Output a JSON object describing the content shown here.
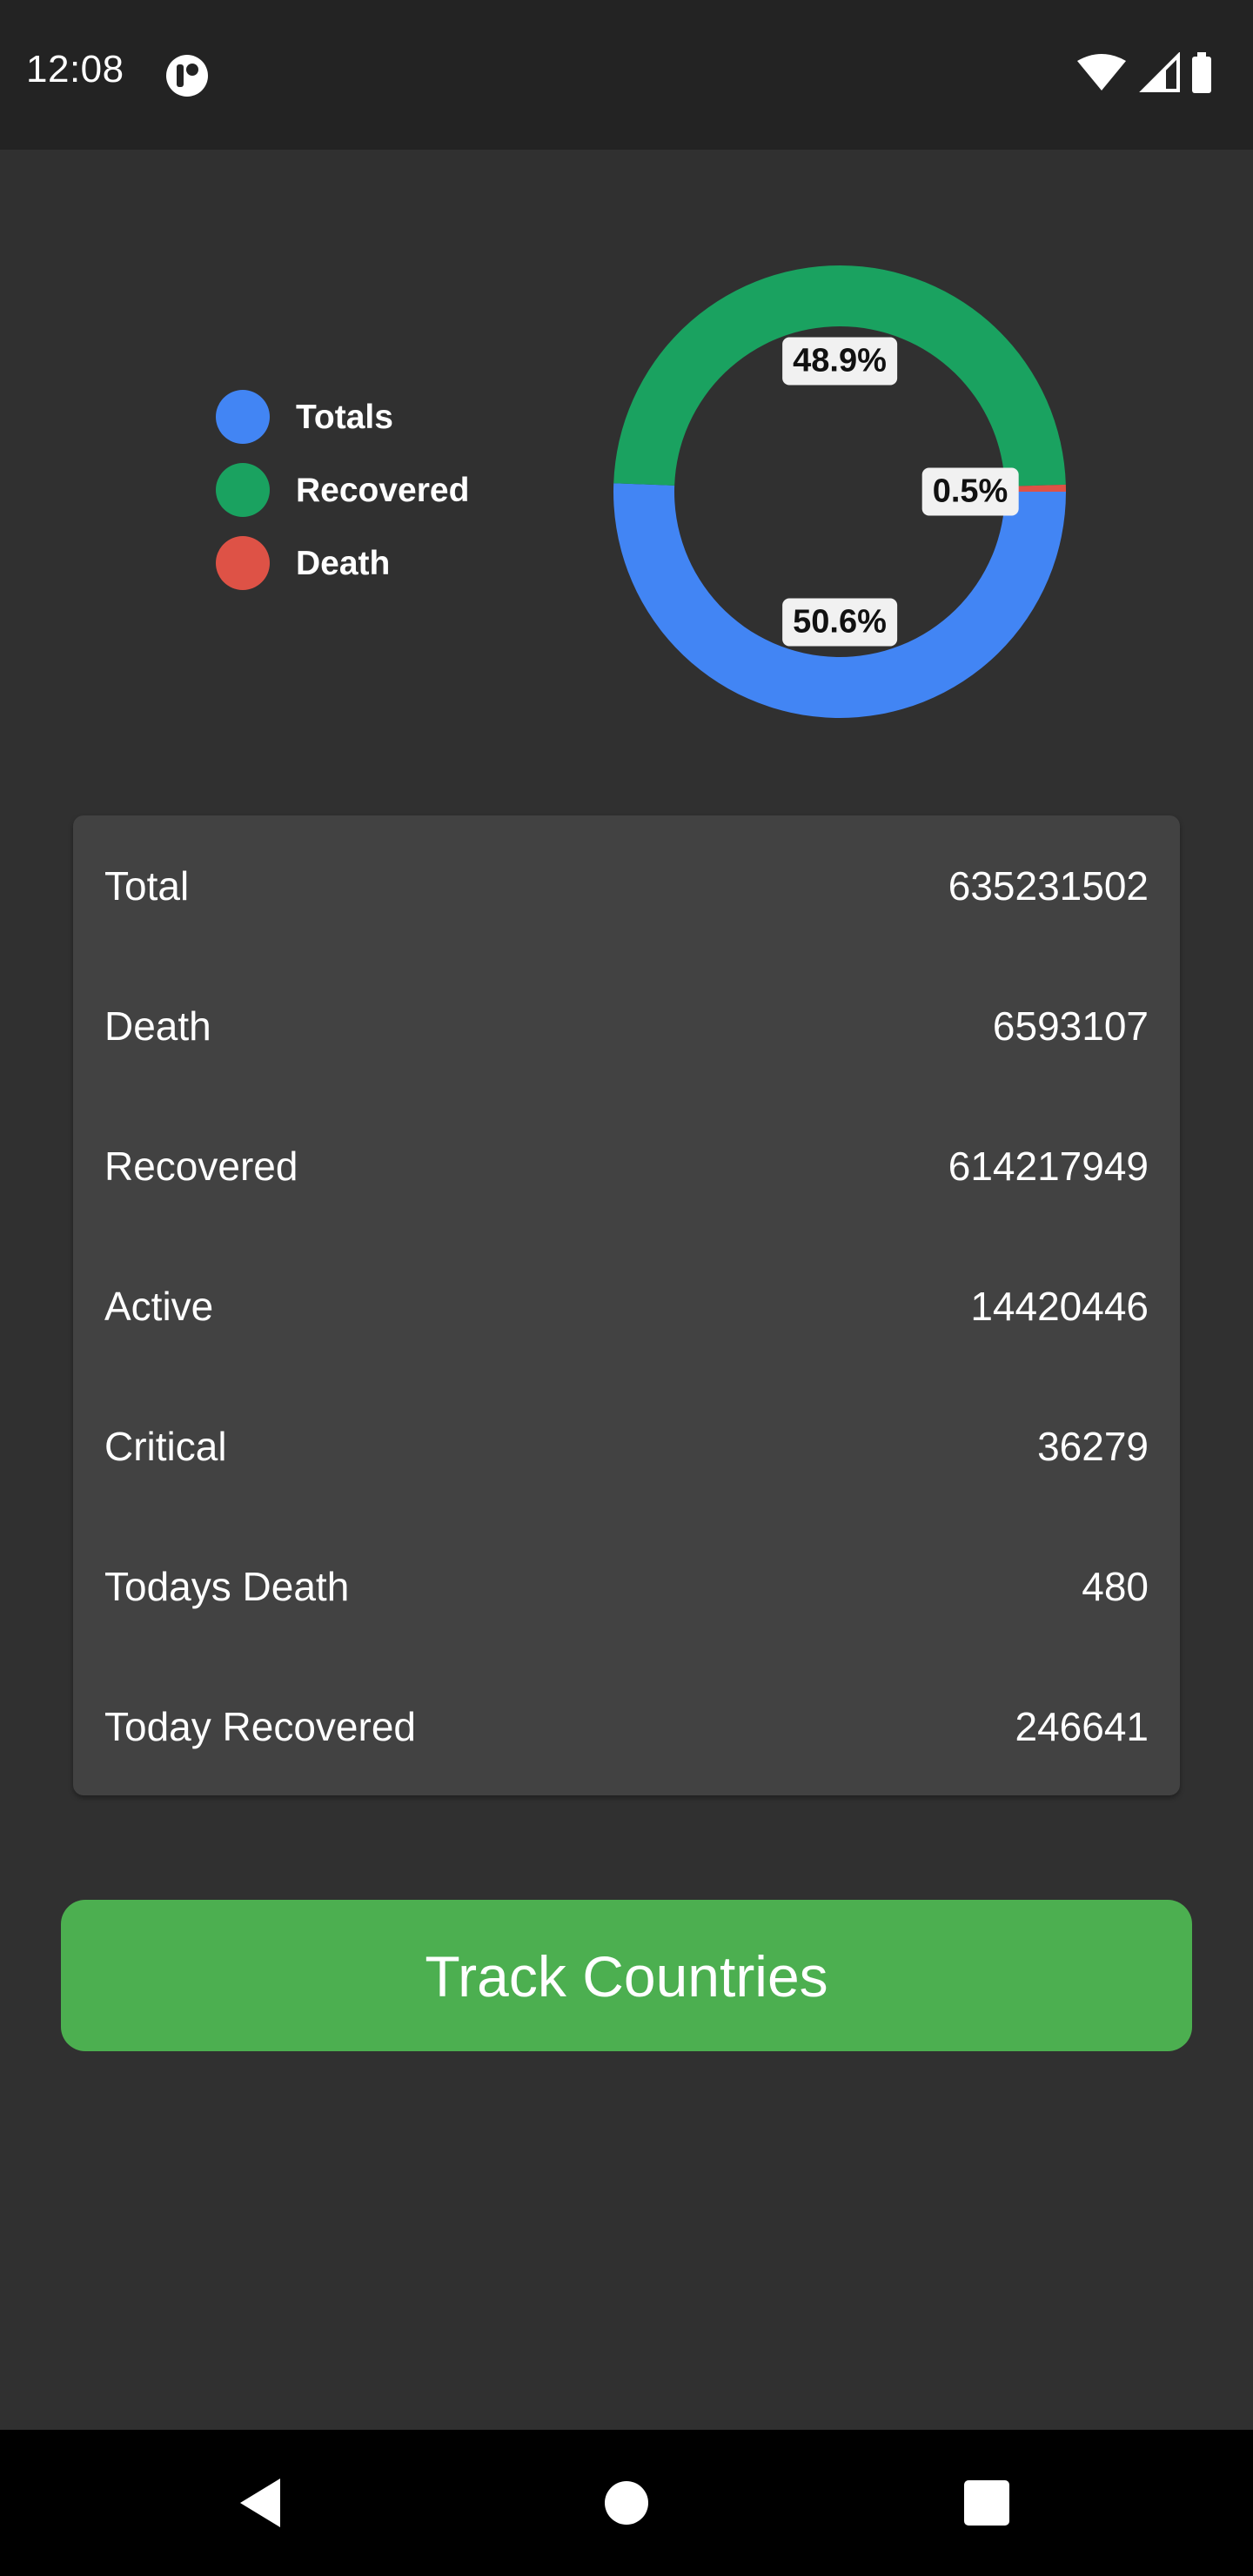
{
  "status_bar": {
    "time": "12:08",
    "app_icon": "notification-app-icon",
    "icons": [
      "wifi-icon",
      "cell-signal-icon",
      "battery-icon"
    ]
  },
  "chart_data": {
    "type": "pie",
    "variant": "donut",
    "legend_position": "left",
    "categories": [
      "Totals",
      "Recovered",
      "Death"
    ],
    "values": [
      50.6,
      48.9,
      0.5
    ],
    "labels": [
      "50.6%",
      "48.9%",
      "0.5%"
    ],
    "colors": [
      "#4285f4",
      "#1aa260",
      "#de5246"
    ]
  },
  "stats": [
    {
      "label": "Total",
      "value": "635231502"
    },
    {
      "label": "Death",
      "value": "6593107"
    },
    {
      "label": "Recovered",
      "value": "614217949"
    },
    {
      "label": "Active",
      "value": "14420446"
    },
    {
      "label": "Critical",
      "value": "36279"
    },
    {
      "label": "Todays Death",
      "value": "480"
    },
    {
      "label": "Today Recovered",
      "value": "246641"
    }
  ],
  "track_button": {
    "label": "Track Countries"
  },
  "colors": {
    "background": "#303030",
    "card": "#424242",
    "button": "#4caf50",
    "status_bar": "#232323"
  },
  "nav_bar": {
    "icons": [
      "back-icon",
      "home-icon",
      "recents-icon"
    ]
  }
}
